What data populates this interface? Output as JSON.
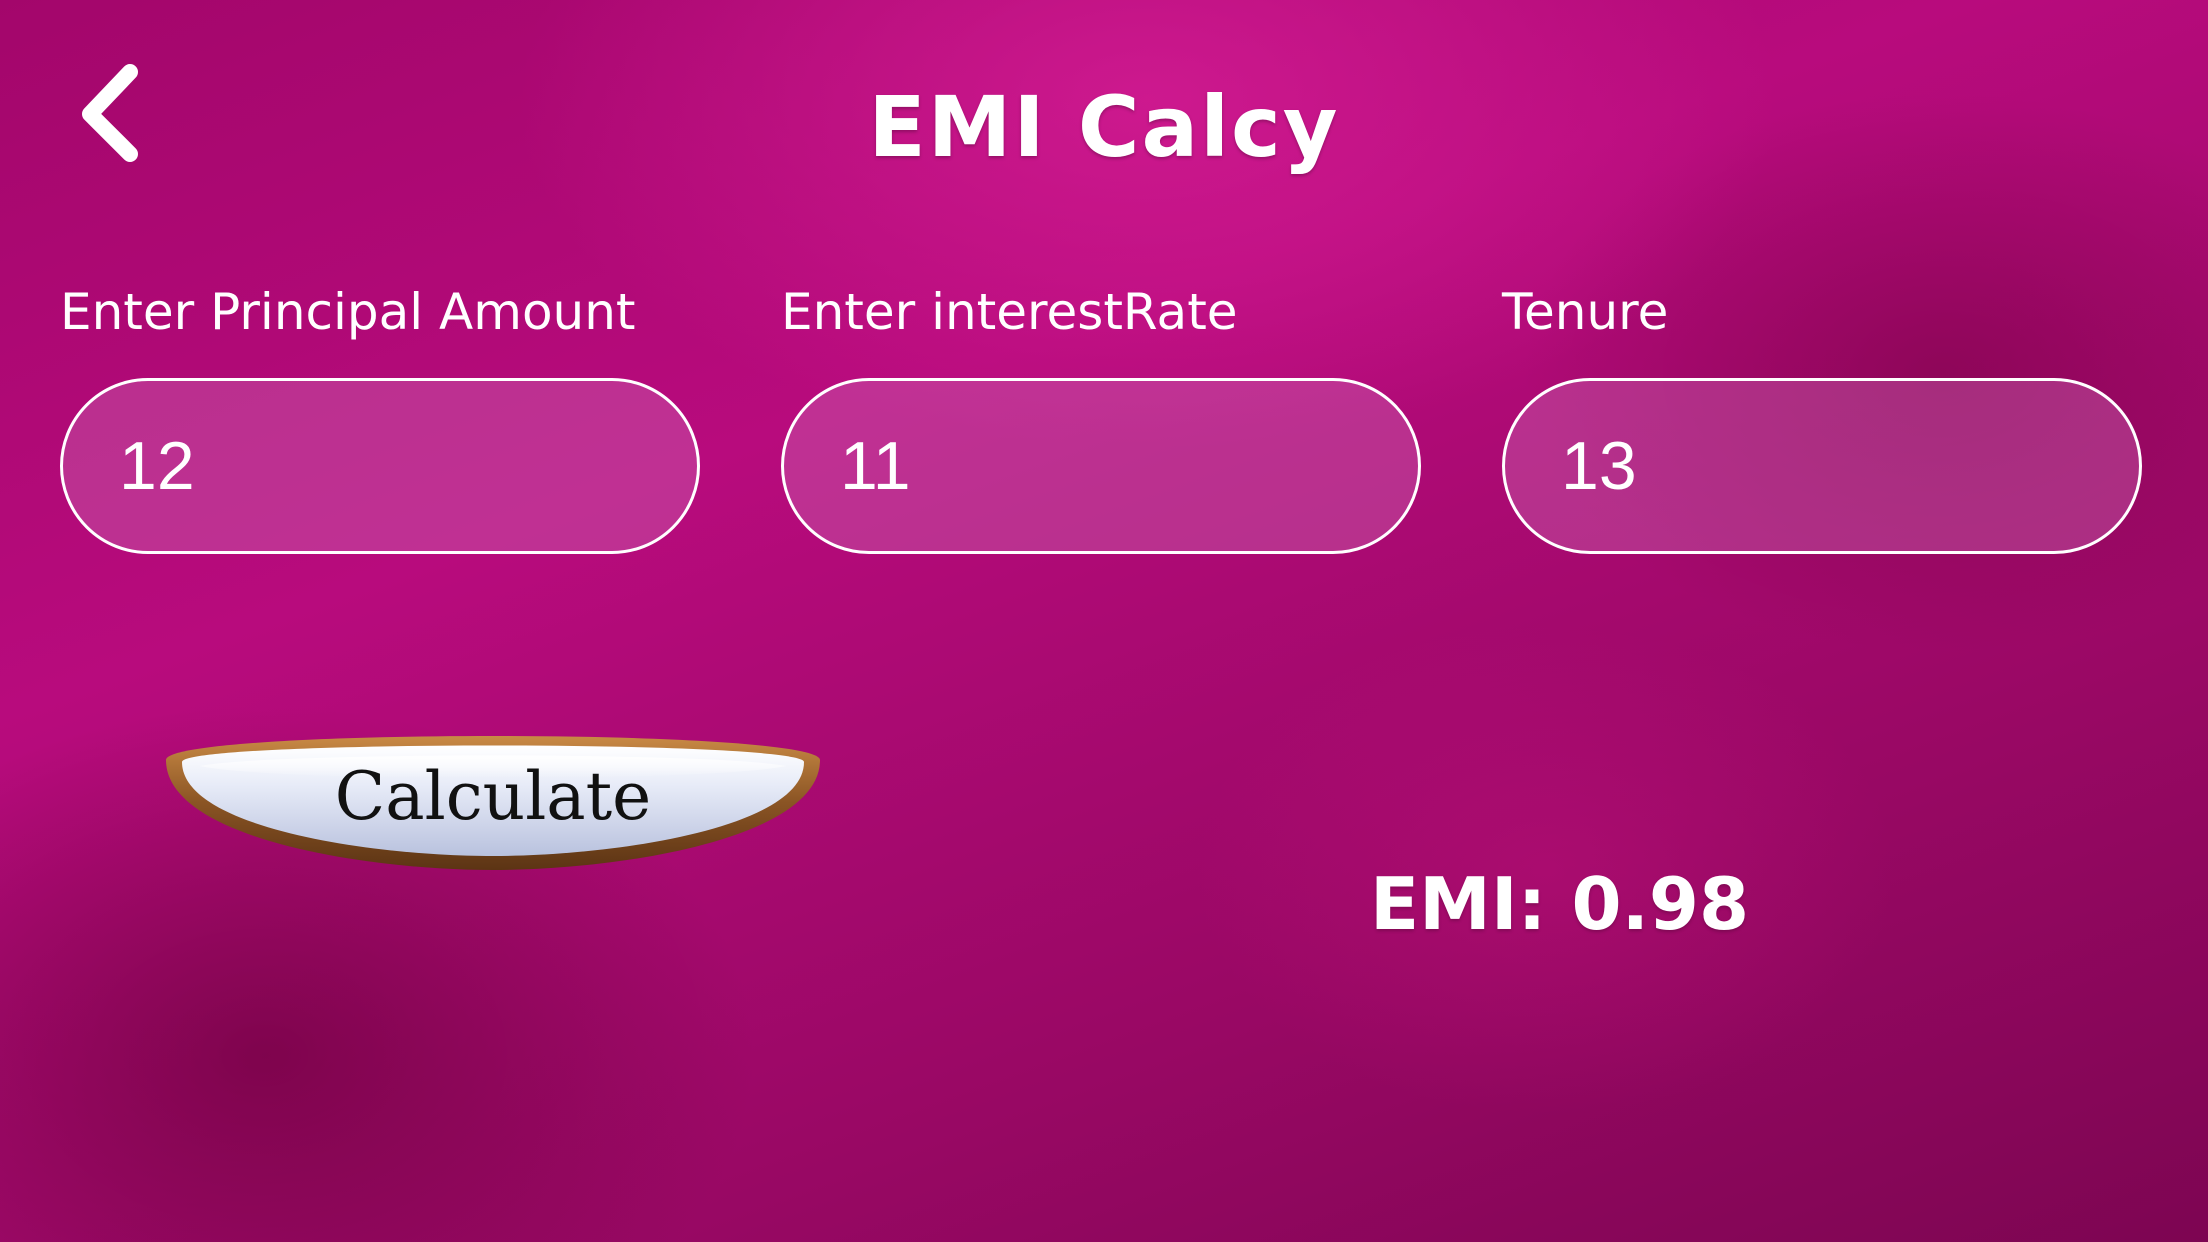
{
  "header": {
    "title": "EMI Calcy",
    "back_icon": "chevron-left-icon"
  },
  "form": {
    "principal": {
      "label": "Enter Principal Amount",
      "value": "12"
    },
    "interest_rate": {
      "label": "Enter interestRate",
      "value": "11"
    },
    "tenure": {
      "label": "Tenure",
      "value": "13"
    }
  },
  "actions": {
    "calculate_label": "Calculate"
  },
  "result": {
    "text": "EMI: 0.98"
  },
  "colors": {
    "background": "#a80a72",
    "text": "#ffffff",
    "button_face": "#dfe4f2",
    "button_rim": "#8a5a2b"
  }
}
